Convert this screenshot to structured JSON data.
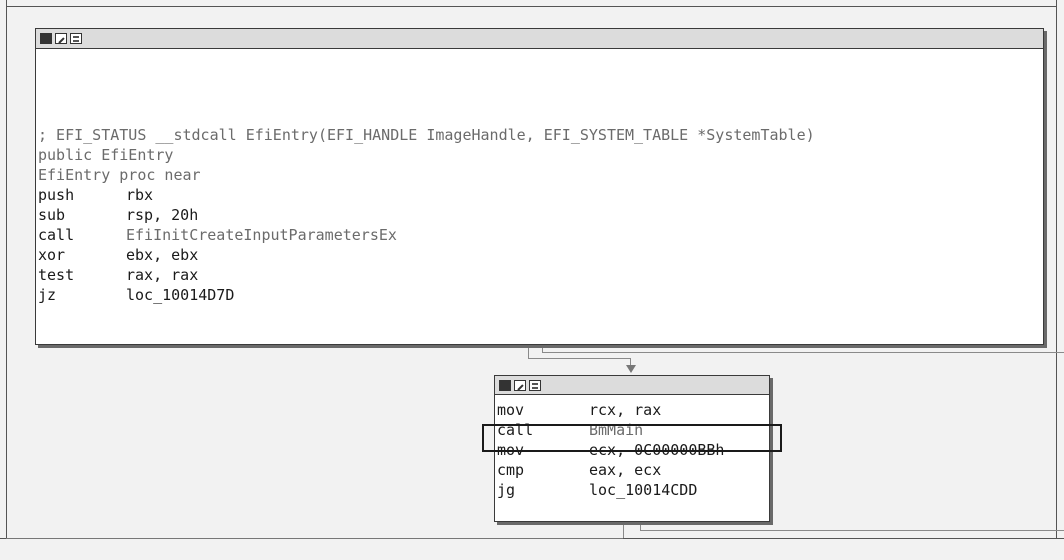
{
  "node1": {
    "comment": "; EFI_STATUS __stdcall EfiEntry(EFI_HANDLE ImageHandle, EFI_SYSTEM_TABLE *SystemTable)",
    "public_line": "public EfiEntry",
    "proc_line": "EfiEntry proc near",
    "instructions": [
      {
        "mnemonic": "push",
        "operands": "rbx"
      },
      {
        "mnemonic": "sub",
        "operands": "rsp, 20h"
      },
      {
        "mnemonic": "call",
        "operands": "EfiInitCreateInputParametersEx"
      },
      {
        "mnemonic": "xor",
        "operands": "ebx, ebx"
      },
      {
        "mnemonic": "test",
        "operands": "rax, rax"
      },
      {
        "mnemonic": "jz",
        "operands": "loc_10014D7D"
      }
    ]
  },
  "node2": {
    "instructions": [
      {
        "mnemonic": "mov",
        "operands": "rcx, rax"
      },
      {
        "mnemonic": "call",
        "operands": "BmMain"
      },
      {
        "mnemonic": "mov",
        "operands": "ecx, 0C00000BBh"
      },
      {
        "mnemonic": "cmp",
        "operands": "eax, ecx"
      },
      {
        "mnemonic": "jg",
        "operands": "loc_10014CDD"
      }
    ]
  },
  "icons": [
    "color-block-icon",
    "rename-icon",
    "graph-view-icon"
  ]
}
